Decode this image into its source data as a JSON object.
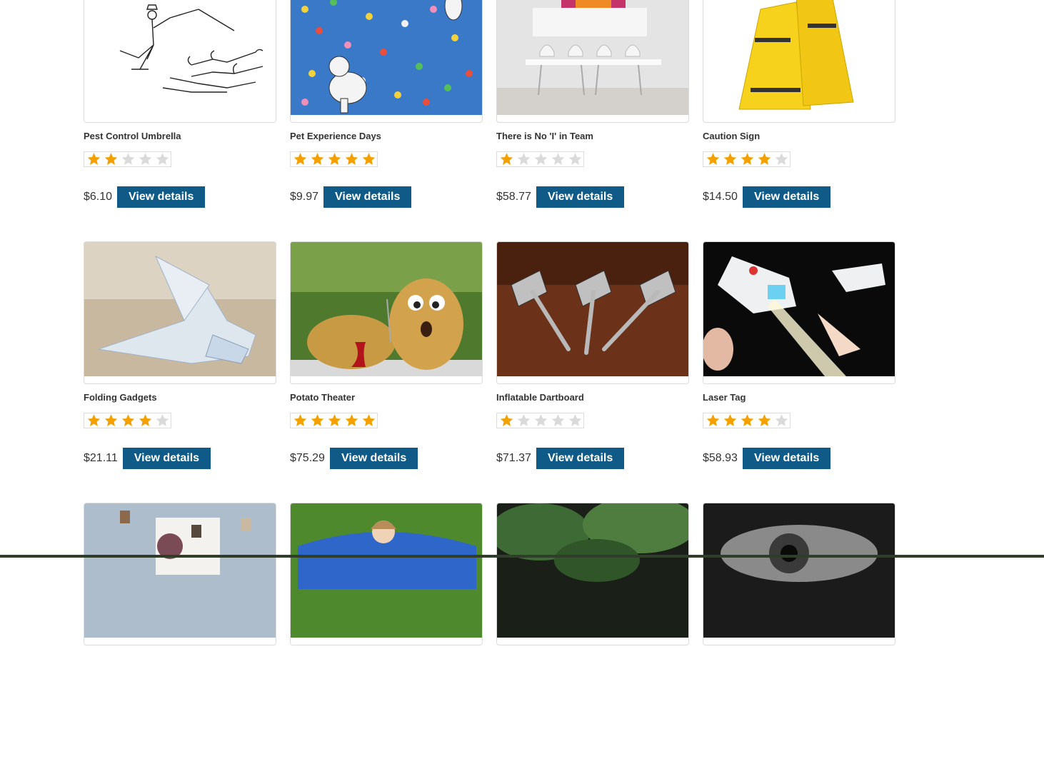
{
  "products": [
    {
      "title": "Pest Control Umbrella",
      "rating": 2,
      "price": "$6.10",
      "button": "View details",
      "image": "umbrella-cats-sketch"
    },
    {
      "title": "Pet Experience Days",
      "rating": 5,
      "price": "$9.97",
      "button": "View details",
      "image": "dogs-balloons"
    },
    {
      "title": "There is No 'I' in Team",
      "rating": 1,
      "price": "$58.77",
      "button": "View details",
      "image": "team-room"
    },
    {
      "title": "Caution Sign",
      "rating": 4,
      "price": "$14.50",
      "button": "View details",
      "image": "caution-sign"
    },
    {
      "title": "Folding Gadgets",
      "rating": 4,
      "price": "$21.11",
      "button": "View details",
      "image": "origami-bird"
    },
    {
      "title": "Potato Theater",
      "rating": 5,
      "price": "$75.29",
      "button": "View details",
      "image": "potatoes"
    },
    {
      "title": "Inflatable Dartboard",
      "rating": 1,
      "price": "$71.37",
      "button": "View details",
      "image": "darts"
    },
    {
      "title": "Laser Tag",
      "rating": 4,
      "price": "$58.93",
      "button": "View details",
      "image": "laser-tag"
    },
    {
      "title": "",
      "rating": 0,
      "price": "",
      "button": "",
      "image": "flying-books"
    },
    {
      "title": "",
      "rating": 0,
      "price": "",
      "button": "",
      "image": "bean-bag-girl"
    },
    {
      "title": "",
      "rating": 0,
      "price": "",
      "button": "",
      "image": "leaves"
    },
    {
      "title": "",
      "rating": 0,
      "price": "",
      "button": "",
      "image": "eye"
    }
  ],
  "colors": {
    "star_on": "#f4a100",
    "star_off": "#dadada",
    "button": "#0f5a87",
    "footer": "#2f3d2a"
  }
}
